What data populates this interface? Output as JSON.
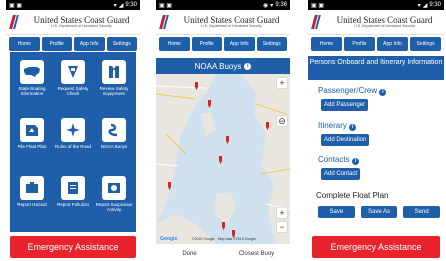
{
  "statusbar": {
    "time1": "9:30",
    "time2": "9:36",
    "time3": "9:30"
  },
  "header": {
    "title": "United States Coast Guard",
    "subtitle": "U.S. Department of Homeland Security"
  },
  "tabs": [
    {
      "label": "Home"
    },
    {
      "label": "Profile"
    },
    {
      "label": "App Info"
    },
    {
      "label": "Settings"
    }
  ],
  "home": {
    "tiles": [
      {
        "label": "State Boating Information",
        "icon": "us-map-icon"
      },
      {
        "label": "Request Safety Check",
        "icon": "safety-check-icon"
      },
      {
        "label": "Review Safety Equipment",
        "icon": "life-jacket-icon"
      },
      {
        "label": "File Float Plan",
        "icon": "float-plan-icon"
      },
      {
        "label": "Rules of the Road",
        "icon": "compass-icon"
      },
      {
        "label": "NOAA Buoys",
        "icon": "buoy-icon"
      },
      {
        "label": "Report Hazard",
        "icon": "hazard-icon"
      },
      {
        "label": "Report Pollution",
        "icon": "pollution-icon"
      },
      {
        "label": "Report Suspicious Activity",
        "icon": "suspicious-activity-icon"
      }
    ],
    "emergency": "Emergency Assistance"
  },
  "buoys": {
    "title": "NOAA Buoys",
    "done": "Done",
    "closest": "Closest Buoy",
    "google": "Google",
    "copyright": "©2015 Google · Map data ©2015 Google"
  },
  "floatplan": {
    "title": "Persons Onboard and Itinerary Information",
    "passenger": "Passenger/Crew",
    "add_passenger": "Add Passenger",
    "itinerary": "Itinerary",
    "add_destination": "Add Destination",
    "contacts": "Contacts",
    "add_contact": "Add Contact",
    "complete": "Complete Float Plan",
    "save": "Save",
    "save_as": "Save As",
    "send": "Send",
    "emergency": "Emergency Assistance"
  }
}
